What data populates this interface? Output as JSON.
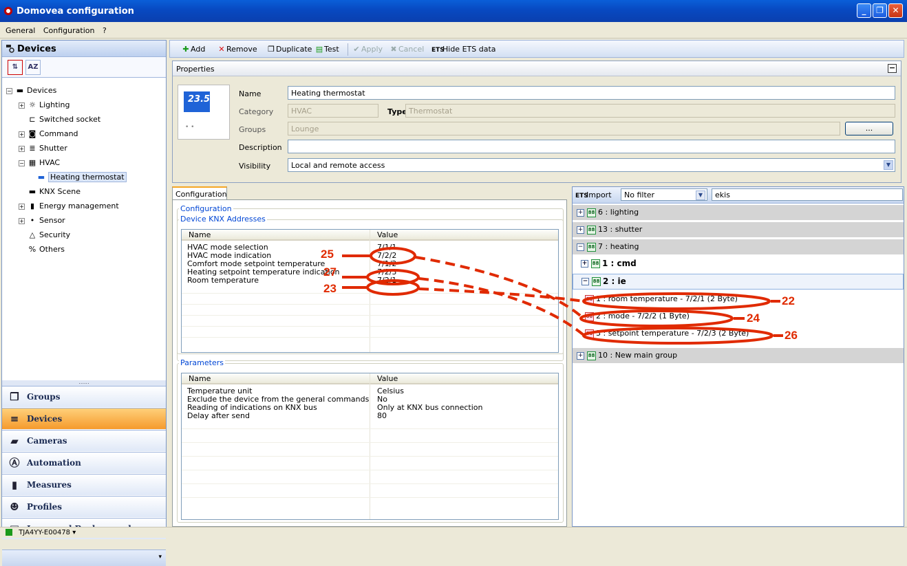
{
  "window": {
    "title": "Domovea configuration",
    "btn_min": "_",
    "btn_max": "❐",
    "btn_close": "✕"
  },
  "menu": {
    "general": "General",
    "configuration": "Configuration",
    "help": "?"
  },
  "left": {
    "header": "Devices",
    "sort_type": "⇅",
    "sort_alpha": "AZ",
    "tree": {
      "root": "Devices",
      "lighting": "Lighting",
      "socket": "Switched socket",
      "command": "Command",
      "shutter": "Shutter",
      "hvac": "HVAC",
      "heating": "Heating thermostat",
      "knx": "KNX Scene",
      "energy": "Energy management",
      "sensor": "Sensor",
      "security": "Security",
      "others": "Others"
    },
    "splitter": "......",
    "nav": {
      "groups": "Groups",
      "devices": "Devices",
      "cameras": "Cameras",
      "automation": "Automation",
      "measures": "Measures",
      "profiles": "Profiles",
      "icons": "Icons and Backgrounds"
    },
    "footer_arrow": "▾"
  },
  "toolbar": {
    "add": "Add",
    "remove": "Remove",
    "duplicate": "Duplicate",
    "test": "Test",
    "apply": "Apply",
    "cancel": "Cancel",
    "hide_ets": "Hide ETS data"
  },
  "properties": {
    "title": "Properties",
    "collapse": "−",
    "thumb_display": "23.5",
    "thumb_dots": "• •",
    "name_label": "Name",
    "name_value": "Heating thermostat",
    "category_label": "Category",
    "category_value": "HVAC",
    "type_label": "Type",
    "type_value": "Thermostat",
    "groups_label": "Groups",
    "groups_value": "Lounge",
    "groups_button": "...",
    "description_label": "Description",
    "description_value": "",
    "visibility_label": "Visibility",
    "visibility_value": "Local and remote access"
  },
  "config": {
    "tab": "Configuration",
    "group_title": "Configuration",
    "knx_title": "Device KNX Addresses",
    "col_name": "Name",
    "col_value": "Value",
    "rows": [
      {
        "name": "HVAC mode selection",
        "value": "7/1/1"
      },
      {
        "name": "HVAC mode indication",
        "value": "7/2/2"
      },
      {
        "name": "Comfort mode setpoint temperature",
        "value": "7/1/2"
      },
      {
        "name": "Heating setpoint temperature indication",
        "value": "7/2/3"
      },
      {
        "name": "Room temperature",
        "value": "7/2/1"
      }
    ],
    "params_title": "Parameters",
    "params": [
      {
        "name": "Temperature unit",
        "value": "Celsius"
      },
      {
        "name": "Exclude the device from the general commands",
        "value": "No"
      },
      {
        "name": "Reading of indications on KNX bus",
        "value": "Only at KNX bus connection"
      },
      {
        "name": "Delay after send",
        "value": "80"
      }
    ]
  },
  "ets": {
    "import": "Import",
    "filter": "No filter",
    "search": "ekis",
    "groups": {
      "g6": "6 : lighting",
      "g13": "13 : shutter",
      "g7": "7 : heating",
      "cmd": "1 : cmd",
      "ie": "2 : ie",
      "o1": "1 : room temperature - 7/2/1 (2 Byte)",
      "o2": "2 : mode - 7/2/2 (1 Byte)",
      "o3": "3 : setpoint temperature - 7/2/3 (2 Byte)",
      "g10": "10 : New main group"
    }
  },
  "annotations": {
    "a25": "25",
    "a27": "27",
    "a23": "23",
    "a22": "22",
    "a24": "24",
    "a26": "26"
  },
  "statusbar": {
    "text": "TJA4YY-E00478 ▾"
  },
  "colors": {
    "annotation": "#e02a00",
    "active_nav": "#f59a2c",
    "title_blue": "#0849c1"
  }
}
